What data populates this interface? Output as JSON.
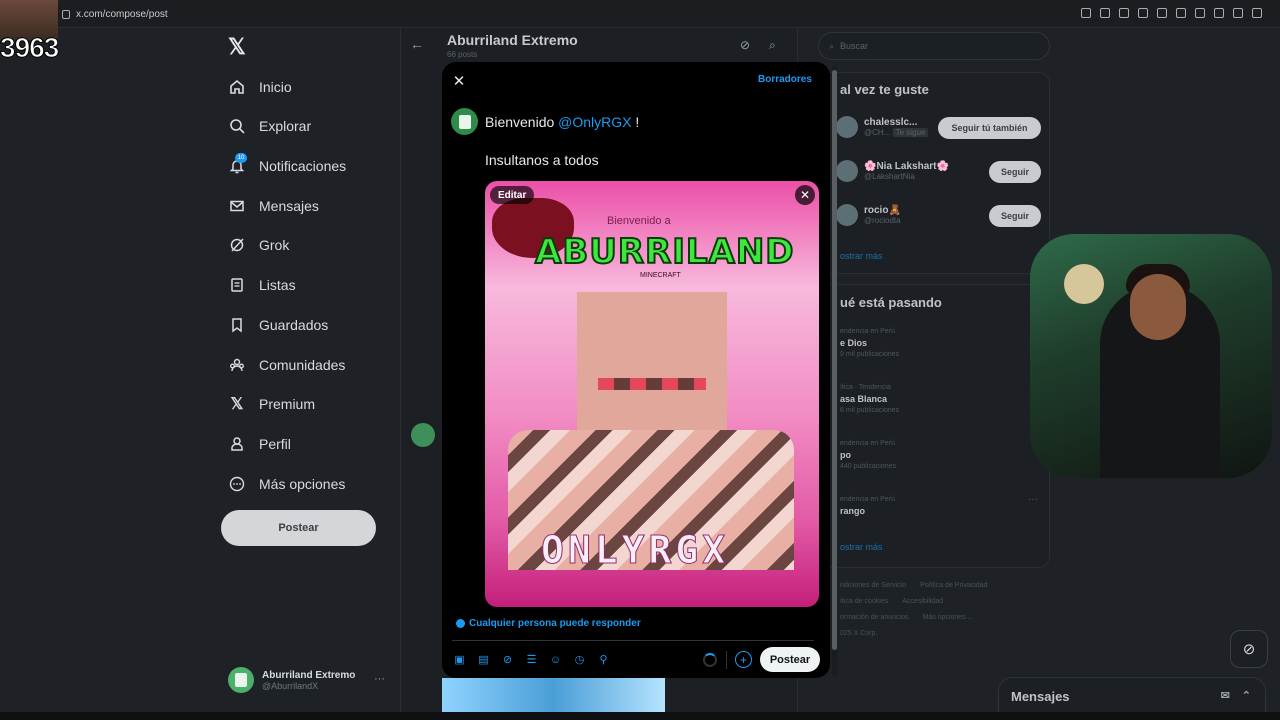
{
  "browser": {
    "url": "x.com/compose/post"
  },
  "overlay": {
    "counter": "3963"
  },
  "nav": {
    "items": [
      {
        "label": "Inicio",
        "icon": "home-icon"
      },
      {
        "label": "Explorar",
        "icon": "search-icon"
      },
      {
        "label": "Notificaciones",
        "icon": "bell-icon",
        "badge": "10"
      },
      {
        "label": "Mensajes",
        "icon": "mail-icon"
      },
      {
        "label": "Grok",
        "icon": "grok-icon"
      },
      {
        "label": "Listas",
        "icon": "list-icon"
      },
      {
        "label": "Guardados",
        "icon": "bookmark-icon"
      },
      {
        "label": "Comunidades",
        "icon": "communities-icon"
      },
      {
        "label": "Premium",
        "icon": "x-logo-icon"
      },
      {
        "label": "Perfil",
        "icon": "person-icon"
      },
      {
        "label": "Más opciones",
        "icon": "more-circle-icon"
      }
    ],
    "post_button": "Postear"
  },
  "account": {
    "name": "Aburriland Extremo",
    "handle": "@AburrilandX"
  },
  "profile_header": {
    "title": "Aburriland Extremo",
    "subtitle": "66 posts"
  },
  "search": {
    "placeholder": "Buscar"
  },
  "suggestions": {
    "title": "al vez te guste",
    "items": [
      {
        "name": "chalesslc...",
        "handle": "@CH...",
        "tag": "Te sigue",
        "button": "Seguir tú también"
      },
      {
        "name": "🌸Nia Lakshart🌸",
        "handle": "@LakshartNia",
        "button": "Seguir"
      },
      {
        "name": "rocio🧸",
        "handle": "@rociodta",
        "button": "Seguir"
      }
    ],
    "show_more": "ostrar más"
  },
  "trends": {
    "title": "ué está pasando",
    "items": [
      {
        "category": "endencia en Perú",
        "name": "e Dios",
        "count": "9 mil publicaciones"
      },
      {
        "category": "ítica · Tendencia",
        "name": "asa Blanca",
        "count": "6 mil publicaciones"
      },
      {
        "category": "endencia en Perú",
        "name": "po",
        "count": "440 publicaciones"
      },
      {
        "category": "endencia en Perú",
        "name": "rango",
        "count": ""
      }
    ],
    "show_more": "ostrar más"
  },
  "footer": {
    "links": [
      "ndiciones de Servicio",
      "Política de Privacidad",
      "ítica de cookies",
      "Accesibilidad",
      "ormación de anuncios",
      "Más opciones ...",
      "025 X Corp."
    ]
  },
  "messages_bar": {
    "label": "Mensajes"
  },
  "compose": {
    "drafts": "Borradores",
    "line1_prefix": "Bienvenido ",
    "mention": "@OnlyRGX",
    "line1_suffix": " !",
    "line2": "Insultanos a todos",
    "media_edit": "Editar",
    "media_text": {
      "welcome": "Bienvenido a",
      "title": "ABURRILAND",
      "subtitle": "MINECRAFT",
      "bottom": "ONLYRGX"
    },
    "reply_setting": "Cualquier persona puede responder",
    "post_button": "Postear"
  }
}
